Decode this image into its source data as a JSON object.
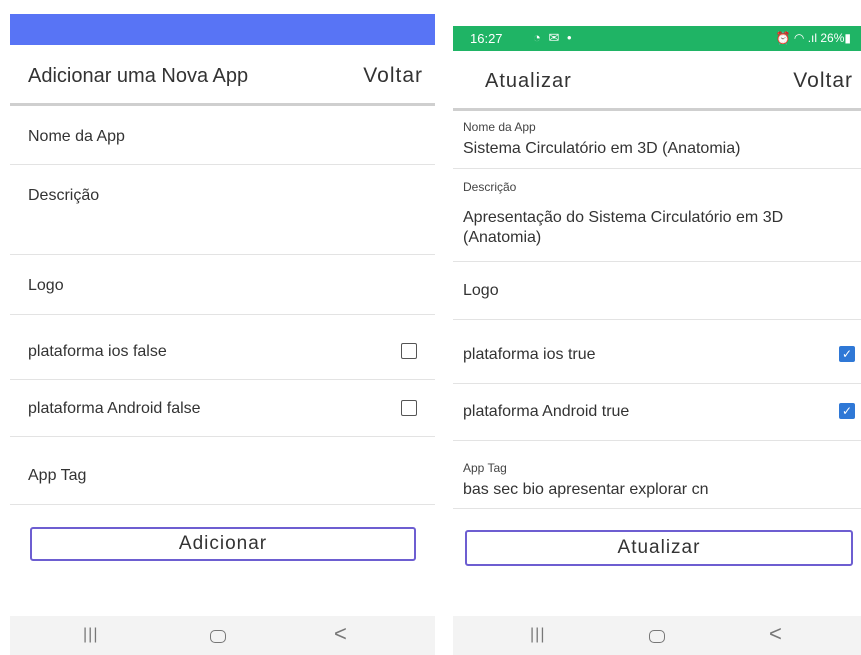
{
  "left": {
    "appbar": {
      "title": "Adicionar uma Nova App",
      "back": "Voltar"
    },
    "fields": {
      "nome": "Nome da App",
      "descricao": "Descrição",
      "logo": "Logo",
      "ios": "plataforma ios false",
      "android": "plataforma Android false",
      "tag": "App Tag"
    },
    "button": "Adicionar",
    "nav": {
      "recent": "|||",
      "back": "<"
    }
  },
  "right": {
    "status": {
      "time": "16:27",
      "left_icons": "◔ ✉ •",
      "right": "⏰ ◠ .ıl 26%▮"
    },
    "appbar": {
      "title": "Atualizar",
      "back": "Voltar"
    },
    "fields": {
      "nome_label": "Nome da App",
      "nome_value": "Sistema Circulatório em 3D (Anatomia)",
      "descricao_label": "Descrição",
      "descricao_value": "Apresentação do Sistema Circulatório em 3D (Anatomia)",
      "logo": "Logo",
      "ios": "plataforma ios true",
      "android": "plataforma Android true",
      "tag_label": "App Tag",
      "tag_value": "bas sec bio apresentar explorar cn"
    },
    "check_mark": "✓",
    "button": "Atualizar",
    "nav": {
      "recent": "|||",
      "back": "<"
    }
  },
  "colors": {
    "left_statusbar": "#5874f5",
    "right_statusbar": "#1fb465",
    "button_border": "#6d5ed1",
    "checkbox_checked": "#2f78d6"
  }
}
